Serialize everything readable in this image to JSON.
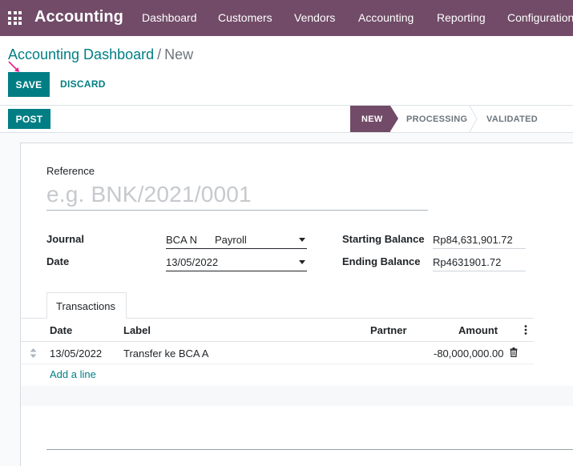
{
  "navbar": {
    "brand": "Accounting",
    "items": [
      "Dashboard",
      "Customers",
      "Vendors",
      "Accounting",
      "Reporting",
      "Configuration"
    ],
    "icon": "apps-grid-icon"
  },
  "breadcrumb": {
    "parent": "Accounting Dashboard",
    "separator": "/",
    "current": "New"
  },
  "actions": {
    "save_label": "SAVE",
    "discard_label": "DISCARD"
  },
  "statusbar": {
    "post_label": "POST",
    "stages": [
      "NEW",
      "PROCESSING",
      "VALIDATED"
    ],
    "active_stage": "NEW",
    "active_color": "#714b67"
  },
  "form": {
    "reference_label": "Reference",
    "reference_placeholder": "e.g. BNK/2021/0001",
    "journal_label": "Journal",
    "journal_value": "BCA N",
    "journal_value_2": "Payroll",
    "date_label": "Date",
    "date_value": "13/05/2022",
    "starting_balance_label": "Starting Balance",
    "starting_balance_value": "Rp84,631,901.72",
    "ending_balance_label": "Ending Balance",
    "ending_balance_value": "Rp4631901.72"
  },
  "transactions": {
    "tab_label": "Transactions",
    "columns": [
      "Date",
      "Label",
      "Partner",
      "Amount"
    ],
    "rows": [
      {
        "date": "13/05/2022",
        "label": "Transfer ke BCA A",
        "partner": "",
        "amount": "-80,000,000.00"
      }
    ],
    "add_line_label": "Add a line"
  },
  "colors": {
    "brand": "#714b67",
    "accent": "#017e84"
  }
}
